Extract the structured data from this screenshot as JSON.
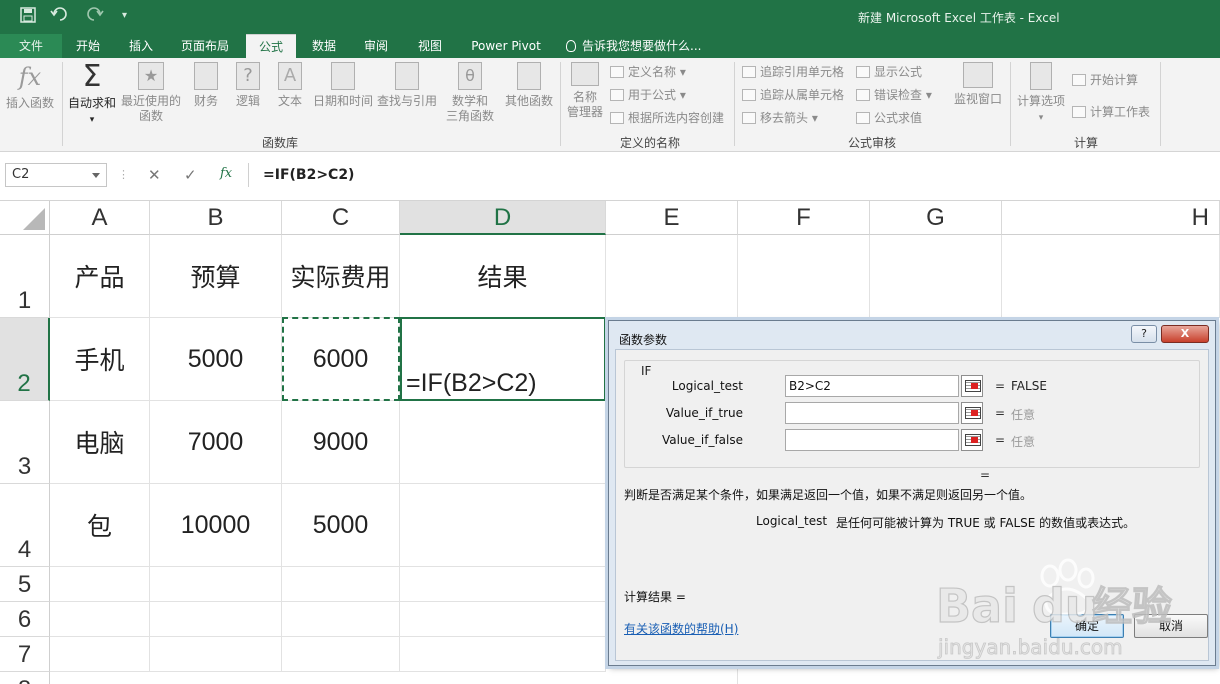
{
  "titlebar": {
    "title": "新建 Microsoft Excel 工作表 - Excel",
    "save_icon": "save-icon",
    "undo_icon": "undo-icon",
    "redo_icon": "redo-icon"
  },
  "tabs": {
    "file": "文件",
    "home": "开始",
    "insert": "插入",
    "page_layout": "页面布局",
    "formulas": "公式",
    "data": "数据",
    "review": "审阅",
    "view": "视图",
    "power_pivot": "Power Pivot",
    "tell_me": "告诉我您想要做什么..."
  },
  "ribbon": {
    "insert_function": "插入函数",
    "autosum": "自动求和",
    "recently_used": "最近使用的",
    "recently_used_2": "函数",
    "financial": "财务",
    "logical": "逻辑",
    "text": "文本",
    "date_time": "日期和时间",
    "lookup": "查找与引用",
    "math_trig": "数学和",
    "math_trig_2": "三角函数",
    "more_functions": "其他函数",
    "group_library": "函数库",
    "name_manager": "名称",
    "name_manager_2": "管理器",
    "define_name": "定义名称",
    "use_in_formula": "用于公式",
    "create_from_selection": "根据所选内容创建",
    "group_names": "定义的名称",
    "trace_precedents": "追踪引用单元格",
    "trace_dependents": "追踪从属单元格",
    "remove_arrows": "移去箭头",
    "show_formulas": "显示公式",
    "error_checking": "错误检查",
    "evaluate_formula": "公式求值",
    "group_auditing": "公式审核",
    "watch_window": "监视窗口",
    "calc_options": "计算选项",
    "calc_now": "开始计算",
    "calc_sheet": "计算工作表",
    "group_calc": "计算"
  },
  "formula_bar": {
    "name_box": "C2",
    "formula": "=IF(B2>C2)",
    "fx": "fx"
  },
  "grid": {
    "columns": [
      "A",
      "B",
      "C",
      "D",
      "E",
      "F",
      "G",
      "H"
    ],
    "rows": [
      "1",
      "2",
      "3",
      "4",
      "5",
      "6",
      "7",
      "8"
    ],
    "cells": [
      [
        "产品",
        "预算",
        "实际费用",
        "结果"
      ],
      [
        "手机",
        "5000",
        "6000",
        ""
      ],
      [
        "电脑",
        "7000",
        "9000",
        ""
      ],
      [
        "包",
        "10000",
        "5000",
        ""
      ]
    ],
    "editing_text": "=IF(B2>C2)"
  },
  "dialog": {
    "title": "函数参数",
    "help_glyph": "?",
    "close_glyph": "X",
    "function_name": "IF",
    "args": [
      {
        "label": "Logical_test",
        "value": "B2>C2",
        "eq": "=",
        "result": "FALSE"
      },
      {
        "label": "Value_if_true",
        "value": "",
        "eq": "=",
        "result": "任意"
      },
      {
        "label": "Value_if_false",
        "value": "",
        "eq": "=",
        "result": "任意"
      }
    ],
    "mid_eq": "=",
    "description": "判断是否满足某个条件，如果满足返回一个值，如果不满足则返回另一个值。",
    "arg_name": "Logical_test",
    "arg_description": "是任何可能被计算为 TRUE 或 FALSE 的数值或表达式。",
    "result_label": "计算结果 =",
    "help_link": "有关该函数的帮助(H)",
    "ok": "确定",
    "cancel": "取消"
  },
  "watermark": {
    "brand": "Bai",
    "brand_2": "du",
    "brand_3": "经验",
    "url": "jingyan.baidu.com"
  },
  "colors": {
    "excel_green": "#217346",
    "dialog_frame": "#c4d4e6",
    "link_blue": "#1a5fb4"
  }
}
